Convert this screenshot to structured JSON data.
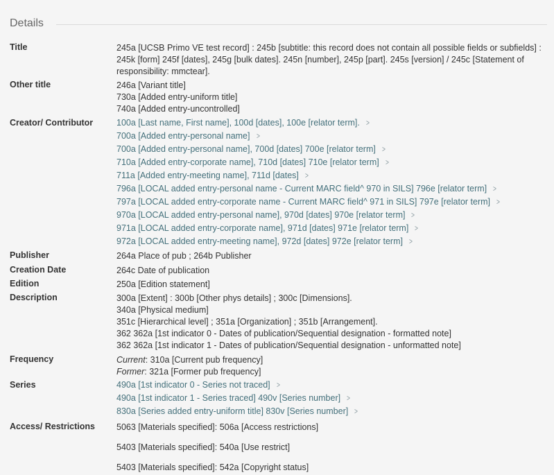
{
  "section": {
    "title": "Details"
  },
  "title": {
    "label": "Title",
    "value": "245a [UCSB Primo VE test record] : 245b [subtitle: this record does not contain all possible fields or subfields] : 245k [form] 245f [dates], 245g [bulk dates]. 245n [number], 245p [part]. 245s [version] / 245c [Statement of responsibility: mmctear]."
  },
  "other_title": {
    "label": "Other title",
    "values": [
      "246a [Variant title]",
      "730a [Added entry-uniform title]",
      "740a [Added entry-uncontrolled]"
    ]
  },
  "creator": {
    "label": "Creator/ Contributor",
    "links": [
      "100a [Last name, First name], 100d [dates], 100e [relator term].",
      "700a [Added entry-personal name]",
      "700a [Added entry-personal name], 700d [dates] 700e [relator term]",
      "710a [Added entry-corporate name], 710d [dates] 710e [relator term]",
      "711a [Added entry-meeting name], 711d [dates]",
      "796a [LOCAL added entry-personal name - Current MARC field^ 970 in SILS] 796e [relator term]",
      "797a [LOCAL added entry-corporate name - Current MARC field^ 971 in SILS] 797e [relator term]",
      "970a [LOCAL added entry-personal name], 970d [dates] 970e [relator term]",
      "971a [LOCAL added entry-corporate name], 971d [dates] 971e [relator term]",
      "972a [LOCAL added entry-meeting name], 972d [dates] 972e [relator term]"
    ]
  },
  "publisher": {
    "label": "Publisher",
    "value": "264a Place of pub ; 264b Publisher"
  },
  "creation_date": {
    "label": "Creation Date",
    "value": "264c Date of publication"
  },
  "edition": {
    "label": "Edition",
    "value": "250a [Edition statement]"
  },
  "description": {
    "label": "Description",
    "values": [
      "300a [Extent] : 300b [Other phys details] ; 300c [Dimensions].",
      "340a [Physical medium]",
      "351c [Hierarchical level] ; 351a [Organization] ; 351b [Arrangement].",
      "362 362a [1st indicator 0 - Dates of publication/Sequential designation - formatted note]",
      "362 362a [1st indicator 1 - Dates of publication/Sequential designation - unformatted note]"
    ]
  },
  "frequency": {
    "label": "Frequency",
    "current_prefix": "Current",
    "current_value": ": 310a [Current pub frequency]",
    "former_prefix": "Former",
    "former_value": ": 321a [Former pub frequency]"
  },
  "series": {
    "label": "Series",
    "links": [
      "490a [1st indicator 0 - Series not traced]",
      "490a [1st indicator 1 - Series traced] 490v [Series number]",
      "830a [Series added entry-uniform title] 830v [Series number]"
    ]
  },
  "access": {
    "label": "Access/ Restrictions",
    "values": [
      "5063 [Materials specified]: 506a [Access restrictions]",
      "5403 [Materials specified]: 540a [Use restrict]",
      "5403 [Materials specified]: 542a [Copyright status]"
    ]
  }
}
